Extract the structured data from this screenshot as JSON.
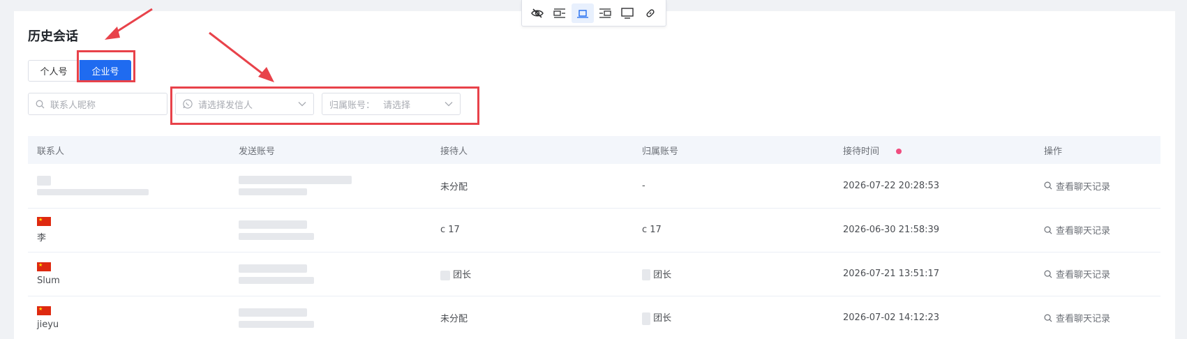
{
  "page_title": "历史会话",
  "tabs": [
    {
      "label": "个人号",
      "active": false
    },
    {
      "label": "企业号",
      "active": true
    }
  ],
  "filters": {
    "contact_placeholder": "联系人昵称",
    "sender_placeholder": "请选择发信人",
    "account_prefix": "归属账号：",
    "account_placeholder": "请选择"
  },
  "toolbar_icons": [
    "eye-slash-icon",
    "layout-left-icon",
    "layout-center-icon",
    "layout-right-icon",
    "monitor-icon",
    "link-icon"
  ],
  "table": {
    "columns": [
      "联系人",
      "发送账号",
      "接待人",
      "归属账号",
      "接待时间",
      "操作"
    ],
    "rows": [
      {
        "contact": "",
        "receiver": "未分配",
        "account": "-",
        "time": "2026-07-22 20:28:53",
        "action": "查看聊天记录",
        "flag": false
      },
      {
        "contact": "李",
        "receiver": "c 17",
        "account": "c 17",
        "time": "2026-06-30 21:58:39",
        "action": "查看聊天记录",
        "flag": true
      },
      {
        "contact": "Slum",
        "receiver": "团长",
        "account": "团长",
        "time": "2026-07-21 13:51:17",
        "action": "查看聊天记录",
        "flag": true
      },
      {
        "contact": "jieyu",
        "receiver": "未分配",
        "account": "团长",
        "time": "2026-07-02 14:12:23",
        "action": "查看聊天记录",
        "flag": true
      }
    ]
  },
  "colors": {
    "accent": "#1f6bf0",
    "annotation": "#e8424a",
    "sort_dot": "#f04d7f"
  }
}
